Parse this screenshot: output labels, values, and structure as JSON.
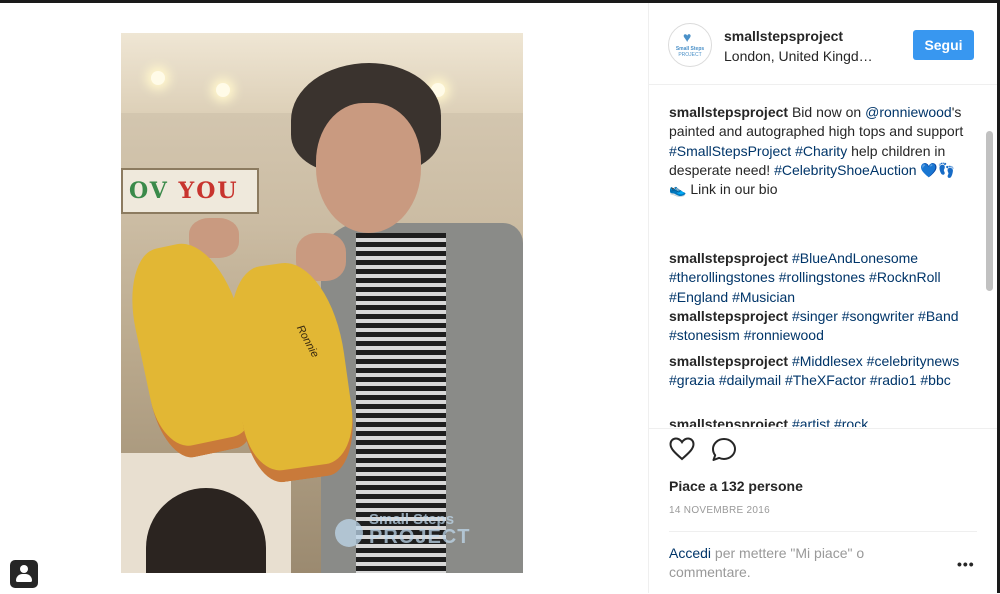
{
  "post": {
    "username": "smallstepsproject",
    "location": "London, United Kingd…",
    "follow_label": "Segui",
    "avatar_text_1": "Small Steps",
    "avatar_text_2": "PROJECT",
    "photo": {
      "sign_text": "OV",
      "sign_text_2": "YOU",
      "signature": "Ronnie",
      "watermark_1": "Small Steps",
      "watermark_2": "PROJECT"
    },
    "comments": [
      {
        "user": "smallstepsproject",
        "parts": [
          {
            "t": " Bid now on "
          },
          {
            "t": "@ronniewood",
            "tag": true
          },
          {
            "t": "'s painted and autographed high tops and support "
          },
          {
            "t": "#SmallStepsProject",
            "tag": true
          },
          {
            "t": " "
          },
          {
            "t": "#Charity",
            "tag": true
          },
          {
            "t": " help children in desperate need! "
          },
          {
            "t": "#CelebrityShoeAuction",
            "tag": true
          },
          {
            "t": " 💙👣👟 Link in our bio"
          }
        ]
      },
      {
        "user": "smallstepsproject",
        "parts": [
          {
            "t": " "
          },
          {
            "t": "#BlueAndLonesome",
            "tag": true
          },
          {
            "t": " "
          },
          {
            "t": "#therollingstones",
            "tag": true
          },
          {
            "t": " "
          },
          {
            "t": "#rollingstones",
            "tag": true
          },
          {
            "t": " "
          },
          {
            "t": "#RocknRoll",
            "tag": true
          },
          {
            "t": " "
          },
          {
            "t": "#England",
            "tag": true
          },
          {
            "t": " "
          },
          {
            "t": "#Musician",
            "tag": true
          }
        ]
      },
      {
        "user": "smallstepsproject",
        "parts": [
          {
            "t": " "
          },
          {
            "t": "#singer",
            "tag": true
          },
          {
            "t": " "
          },
          {
            "t": "#songwriter",
            "tag": true
          },
          {
            "t": " "
          },
          {
            "t": "#Band",
            "tag": true
          },
          {
            "t": " "
          },
          {
            "t": "#stonesism",
            "tag": true
          },
          {
            "t": " "
          },
          {
            "t": "#ronniewood",
            "tag": true
          }
        ]
      },
      {
        "user": "smallstepsproject",
        "parts": [
          {
            "t": " "
          },
          {
            "t": "#Middlesex",
            "tag": true
          },
          {
            "t": " "
          },
          {
            "t": "#celebritynews",
            "tag": true
          },
          {
            "t": " "
          },
          {
            "t": "#grazia",
            "tag": true
          },
          {
            "t": " "
          },
          {
            "t": "#dailymail",
            "tag": true
          },
          {
            "t": " "
          },
          {
            "t": "#TheXFactor",
            "tag": true
          },
          {
            "t": " "
          },
          {
            "t": "#radio1",
            "tag": true
          },
          {
            "t": " "
          },
          {
            "t": "#bbc",
            "tag": true
          }
        ]
      },
      {
        "user": "smallstepsproject",
        "parts": [
          {
            "t": " "
          },
          {
            "t": "#artist",
            "tag": true
          },
          {
            "t": " "
          },
          {
            "t": "#rock",
            "tag": true
          }
        ]
      }
    ],
    "likes": "Piace a 132 persone",
    "date": "14 NOVEMBRE 2016",
    "login_link": "Accedi",
    "login_text": " per mettere \"Mi piace\" o commentare.",
    "more_label": "•••"
  },
  "icons": {
    "like": "heart-outline-icon",
    "comment": "speech-bubble-icon",
    "more": "more-options-icon",
    "user_tag": "user-tag-icon"
  },
  "colors": {
    "follow_button": "#3897f0",
    "hashtag": "#003569",
    "muted": "#999999",
    "border": "#efefef"
  }
}
